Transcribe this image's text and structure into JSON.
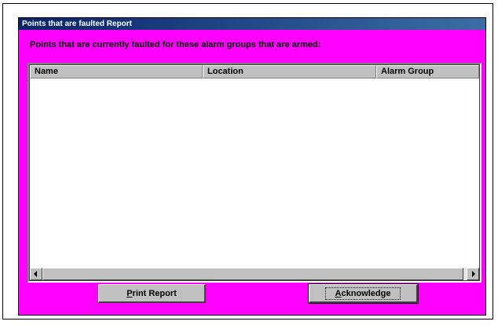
{
  "window": {
    "title": "Points that are faulted Report"
  },
  "heading": "Points that are currently faulted for these alarm groups that are armed:",
  "table": {
    "columns": [
      "Name",
      "Location",
      "Alarm Group"
    ],
    "rows": []
  },
  "buttons": {
    "print": {
      "mnemonic": "P",
      "rest": "rint Report"
    },
    "acknowledge": {
      "mnemonic": "A",
      "rest": "cknowledge"
    }
  },
  "colors": {
    "dialog_background": "#ff00ff",
    "titlebar_start": "#0a246a",
    "titlebar_end": "#3a6ea5",
    "control_face": "#c0c0c0"
  }
}
